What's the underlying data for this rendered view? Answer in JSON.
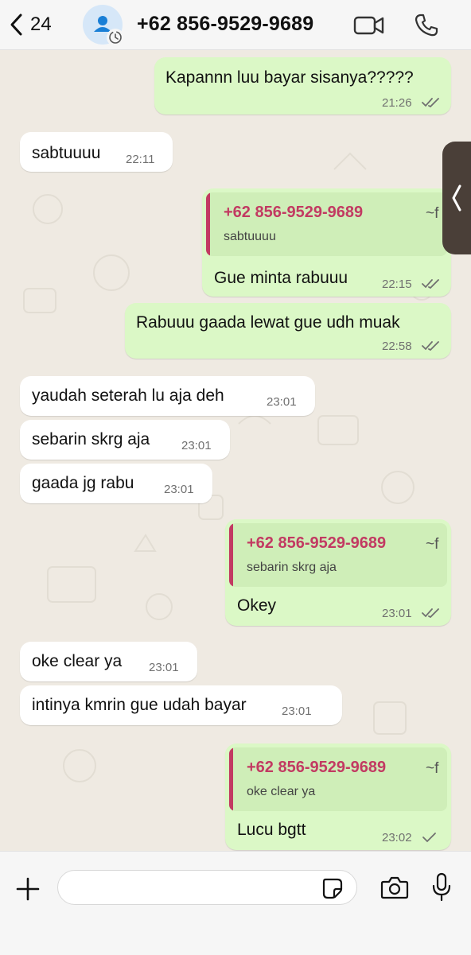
{
  "header": {
    "back_count": "24",
    "contact_name": "+62 856-9529-9689"
  },
  "messages": [
    {
      "dir": "out",
      "text": "Kapannn luu bayar sisanya?????",
      "time": "21:26",
      "status": "read"
    },
    {
      "dir": "in",
      "text": "sabtuuuu",
      "time": "22:11"
    },
    {
      "dir": "out",
      "quote_author": "+62 856-9529-9689",
      "quote_tilde": "~f",
      "quote_text": "sabtuuuu",
      "text": "Gue minta rabuuu",
      "time": "22:15",
      "status": "read"
    },
    {
      "dir": "out",
      "text": "Rabuuu gaada lewat gue udh muak",
      "time": "22:58",
      "status": "read"
    },
    {
      "dir": "in",
      "text": "yaudah seterah lu aja deh",
      "time": "23:01"
    },
    {
      "dir": "in",
      "text": "sebarin skrg aja",
      "time": "23:01"
    },
    {
      "dir": "in",
      "text": "gaada jg rabu",
      "time": "23:01"
    },
    {
      "dir": "out",
      "quote_author": "+62 856-9529-9689",
      "quote_tilde": "~f",
      "quote_text": "sebarin skrg aja",
      "text": "Okey",
      "time": "23:01",
      "status": "read"
    },
    {
      "dir": "in",
      "text": "oke clear ya",
      "time": "23:01"
    },
    {
      "dir": "in",
      "text": "intinya kmrin gue udah bayar",
      "time": "23:01"
    },
    {
      "dir": "out",
      "quote_author": "+62 856-9529-9689",
      "quote_tilde": "~f",
      "quote_text": "oke clear ya",
      "text": "Lucu bgtt",
      "time": "23:02",
      "status": "sent"
    }
  ],
  "composer": {
    "placeholder": ""
  },
  "icons": {
    "back": "chevron-left-icon",
    "avatar": "person-icon",
    "disappearing": "timer-icon",
    "video": "video-camera-icon",
    "call": "phone-icon",
    "side_tab": "chevron-left-icon",
    "plus": "plus-icon",
    "sticker": "sticker-icon",
    "camera": "camera-icon",
    "mic": "microphone-icon"
  },
  "colors": {
    "outgoing_bubble": "#dbf8c6",
    "incoming_bubble": "#ffffff",
    "quote_author": "#c23a62",
    "read_ticks": "#707070",
    "icon_blue": "#1a7fd6"
  }
}
